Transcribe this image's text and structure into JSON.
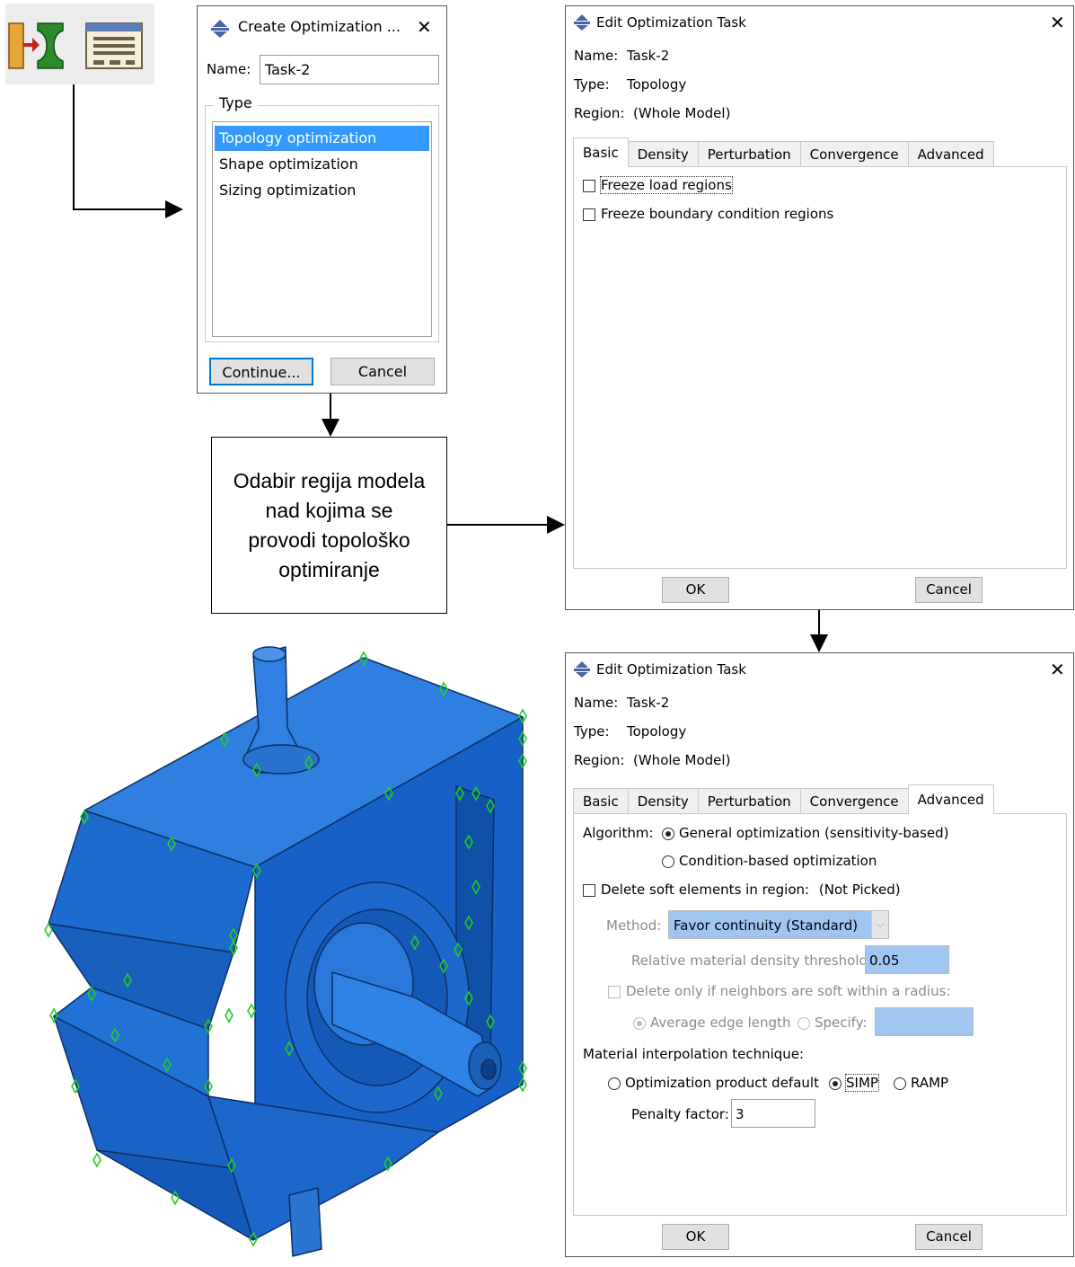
{
  "create_dialog": {
    "title": "Create Optimization ...",
    "name_label": "Name:",
    "name_value": "Task-2",
    "type_label": "Type",
    "types": [
      "Topology optimization",
      "Shape optimization",
      "Sizing optimization"
    ],
    "selected_index": 0,
    "continue_label": "Continue...",
    "cancel_label": "Cancel"
  },
  "note": {
    "lines": [
      "Odabir regija modela",
      "nad kojima se",
      "provodi topološko",
      "optimiranje"
    ]
  },
  "edit_dialog_basic": {
    "title": "Edit Optimization Task",
    "name_label": "Name:",
    "name_value": "Task-2",
    "type_label": "Type:",
    "type_value": "Topology",
    "region_label": "Region:",
    "region_value": "(Whole Model)",
    "tabs": [
      "Basic",
      "Density",
      "Perturbation",
      "Convergence",
      "Advanced"
    ],
    "active_tab": "Basic",
    "options": [
      "Freeze load regions",
      "Freeze boundary condition regions"
    ],
    "ok_label": "OK",
    "cancel_label": "Cancel"
  },
  "edit_dialog_advanced": {
    "title": "Edit Optimization Task",
    "name_label": "Name:",
    "name_value": "Task-2",
    "type_label": "Type:",
    "type_value": "Topology",
    "region_label": "Region:",
    "region_value": "(Whole Model)",
    "tabs": [
      "Basic",
      "Density",
      "Perturbation",
      "Convergence",
      "Advanced"
    ],
    "active_tab": "Advanced",
    "algorithm_label": "Algorithm:",
    "algorithm_options": [
      "General optimization (sensitivity-based)",
      "Condition-based optimization"
    ],
    "algorithm_selected": 0,
    "delete_soft_label": "Delete soft elements in region:",
    "delete_soft_value": "(Not Picked)",
    "method_label": "Method:",
    "method_value": "Favor continuity (Standard)",
    "threshold_label": "Relative material density threshold:",
    "threshold_value": "0.05",
    "neighbors_label": "Delete only if neighbors are soft within a radius:",
    "radius_options": [
      "Average edge length",
      "Specify:"
    ],
    "radius_selected": 0,
    "interp_label": "Material interpolation technique:",
    "interp_options": [
      "Optimization product default",
      "SIMP",
      "RAMP"
    ],
    "interp_selected": 1,
    "penalty_label": "Penalty factor:",
    "penalty_value": "3",
    "ok_label": "OK",
    "cancel_label": "Cancel"
  },
  "colors": {
    "selection": "#3399ff",
    "model_blue": "#1f6ed4",
    "field_highlight": "#9fc6f1",
    "marker_green": "#22cc22"
  }
}
